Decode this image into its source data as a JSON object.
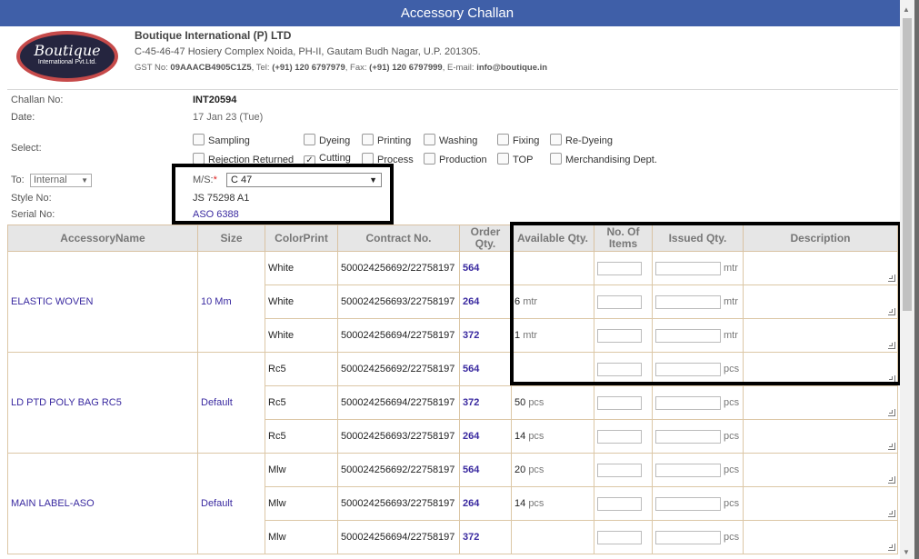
{
  "dialog": {
    "title": "Accessory Challan",
    "close_label": "×"
  },
  "company": {
    "logo_line1": "Boutique",
    "logo_line2": "International Pvt.Ltd.",
    "name": "Boutique International (P) LTD",
    "address": "C-45-46-47 Hosiery Complex Noida, PH-II, Gautam Budh Nagar, U.P. 201305.",
    "gst_label": "GST No:",
    "gst": "09AAACB4905C1Z5",
    "tel_label": ", Tel:",
    "tel": "(+91) 120 6797979",
    "fax_label": ", Fax:",
    "fax": "(+91) 120 6797999",
    "email_label": ", E-mail:",
    "email": "info@boutique.in"
  },
  "form": {
    "challan_label": "Challan No:",
    "challan_no": "INT20594",
    "date_label": "Date:",
    "date": "17 Jan 23 (Tue)",
    "select_label": "Select:",
    "checkboxes": [
      {
        "label": "Sampling",
        "checked": false
      },
      {
        "label": "Dyeing",
        "checked": false
      },
      {
        "label": "Printing",
        "checked": false
      },
      {
        "label": "Washing",
        "checked": false
      },
      {
        "label": "Fixing",
        "checked": false
      },
      {
        "label": "Re-Dyeing",
        "checked": false
      },
      {
        "label": "Rejection Returned",
        "checked": false
      },
      {
        "label": "Cutting",
        "checked": true
      },
      {
        "label": "Process",
        "checked": false
      },
      {
        "label": "Production",
        "checked": false
      },
      {
        "label": "TOP",
        "checked": false
      },
      {
        "label": "Merchandising Dept.",
        "checked": false
      }
    ],
    "to_label": "To:",
    "to_value": "Internal",
    "ms_label": "M/S:",
    "ms_required": "*",
    "ms_value": "C 47",
    "style_label": "Style No:",
    "style_no": "JS 75298 A1",
    "serial_label": "Serial No:",
    "serial_no": "ASO 6388"
  },
  "table": {
    "headers": [
      "AccessoryName",
      "Size",
      "ColorPrint",
      "Contract No.",
      "Order Qty.",
      "Available Qty.",
      "No. Of Items",
      "Issued Qty.",
      "Description"
    ],
    "groups": [
      {
        "name": "ELASTIC WOVEN",
        "size": "10 Mm",
        "rows": [
          {
            "color": "White",
            "contract": "500024256692/22758197",
            "order": "564",
            "avail": "",
            "avail_unit": "",
            "unit": "mtr"
          },
          {
            "color": "White",
            "contract": "500024256693/22758197",
            "order": "264",
            "avail": "6",
            "avail_unit": "mtr",
            "unit": "mtr"
          },
          {
            "color": "White",
            "contract": "500024256694/22758197",
            "order": "372",
            "avail": "1",
            "avail_unit": "mtr",
            "unit": "mtr"
          }
        ]
      },
      {
        "name": "LD PTD POLY BAG RC5",
        "size": "Default",
        "rows": [
          {
            "color": "Rc5",
            "contract": "500024256692/22758197",
            "order": "564",
            "avail": "",
            "avail_unit": "",
            "unit": "pcs"
          },
          {
            "color": "Rc5",
            "contract": "500024256694/22758197",
            "order": "372",
            "avail": "50",
            "avail_unit": "pcs",
            "unit": "pcs"
          },
          {
            "color": "Rc5",
            "contract": "500024256693/22758197",
            "order": "264",
            "avail": "14",
            "avail_unit": "pcs",
            "unit": "pcs"
          }
        ]
      },
      {
        "name": "MAIN LABEL-ASO",
        "size": "Default",
        "rows": [
          {
            "color": "Mlw",
            "contract": "500024256692/22758197",
            "order": "564",
            "avail": "20",
            "avail_unit": "pcs",
            "unit": "pcs"
          },
          {
            "color": "Mlw",
            "contract": "500024256693/22758197",
            "order": "264",
            "avail": "14",
            "avail_unit": "pcs",
            "unit": "pcs"
          },
          {
            "color": "Mlw",
            "contract": "500024256694/22758197",
            "order": "372",
            "avail": "",
            "avail_unit": "",
            "unit": "pcs"
          }
        ]
      }
    ]
  },
  "colors": {
    "titlebar": "#3f5fa8",
    "link": "#3a2aa0",
    "border": "#dcc7a6"
  }
}
